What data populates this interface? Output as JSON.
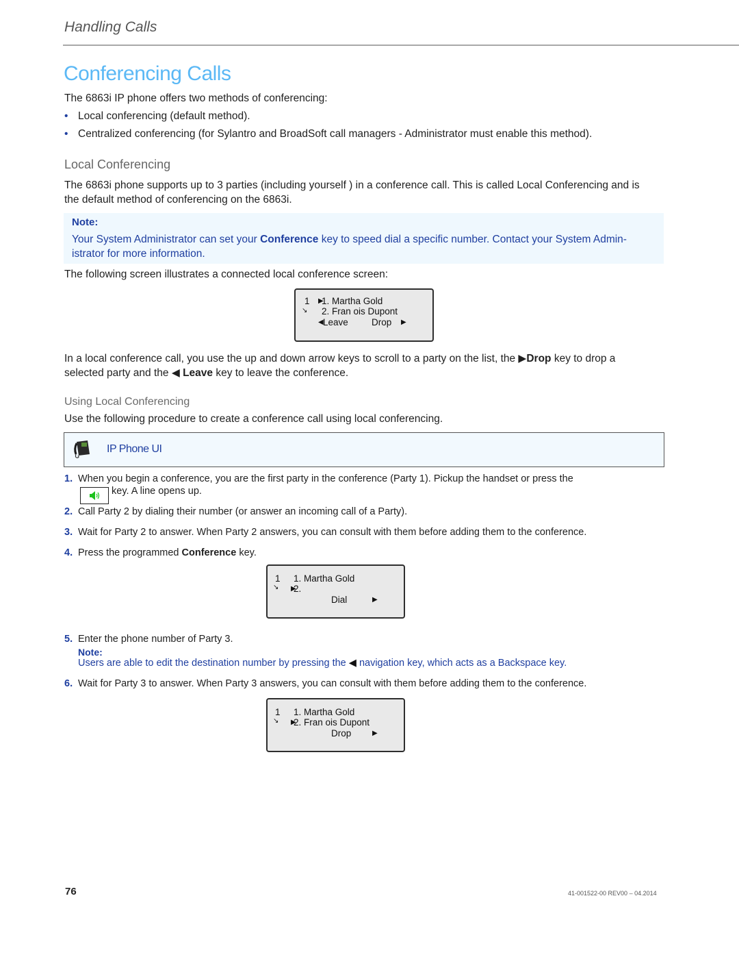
{
  "header": {
    "running_head": "Handling Calls"
  },
  "section": {
    "title": "Conferencing Calls",
    "intro": "The 6863i IP phone offers two methods of conferencing:",
    "bullets": [
      "Local conferencing (default method).",
      "Centralized conferencing (for Sylantro and BroadSoft call managers - Administrator must enable this method)."
    ]
  },
  "local_conferencing": {
    "heading": "Local Conferencing",
    "para_line1": "The 6863i phone supports up to 3 parties (including yourself ) in a conference call. This is called Local Conferencing and is",
    "para_line2": "the default method of conferencing on the 6863i.",
    "note": {
      "title": "Note:",
      "text_before": "Your System Administrator can set your ",
      "text_bold": "Conference",
      "text_after_line1": " key to speed dial a specific number. Contact your System Admin-",
      "text_line2": "istrator for more information."
    },
    "screen_intro": "The following screen illustrates a connected local conference screen:",
    "screen": {
      "line_indicator": "1",
      "row1": "1. Martha Gold",
      "row2": "2. Fran ois Dupont",
      "softkey_left": "Leave",
      "softkey_right": "Drop"
    },
    "explain_line1_a": "In a local conference call, you use the up and down arrow keys to scroll to a party on the list, the ",
    "explain_line1_bold": "Drop",
    "explain_line1_b": " key to drop a",
    "explain_line2_a": "selected party and the ",
    "explain_line2_bold": "Leave",
    "explain_line2_b": " key to leave the conference."
  },
  "using_local": {
    "heading": "Using Local Conferencing",
    "intro": "Use the following procedure to create a conference call using local conferencing.",
    "ui_box_label": "IP Phone UI",
    "steps": [
      {
        "num": "1.",
        "line1": "When you begin a conference, you are the first party in the conference (Party 1). Pickup the handset or press the",
        "line2": "key. A line opens up."
      },
      {
        "num": "2.",
        "text": "Call Party 2 by dialing their number (or answer an incoming call of a Party)."
      },
      {
        "num": "3.",
        "text": "Wait for Party 2 to answer. When Party 2 answers, you can consult with them before adding them to the conference."
      },
      {
        "num": "4.",
        "text_before": "Press the programmed ",
        "text_bold": "Conference",
        "text_after": " key."
      },
      {
        "num": "5.",
        "text": "Enter the phone number of Party 3.",
        "note_title": "Note:",
        "note_before": "Users are able to edit the destination number by pressing the ",
        "note_after": " navigation key, which acts as a Backspace key."
      },
      {
        "num": "6.",
        "text": "Wait for Party 3 to answer. When Party 3 answers, you can consult with them before adding them to the conference."
      }
    ],
    "screen_dial": {
      "line_indicator": "1",
      "row1": "1. Martha Gold",
      "row2": "2.",
      "softkey_right": "Dial"
    },
    "screen_drop": {
      "line_indicator": "1",
      "row1": "1. Martha Gold",
      "row2": "2. Fran ois Dupont",
      "softkey_right": "Drop"
    }
  },
  "footer": {
    "page_number": "76",
    "doc_id": "41-001522-00 REV00 – 04.2014"
  },
  "colors": {
    "title_blue": "#5bb8f5",
    "note_blue": "#1f3fa0",
    "note_bg": "#eff8fe",
    "speaker_green": "#1ec21e"
  }
}
